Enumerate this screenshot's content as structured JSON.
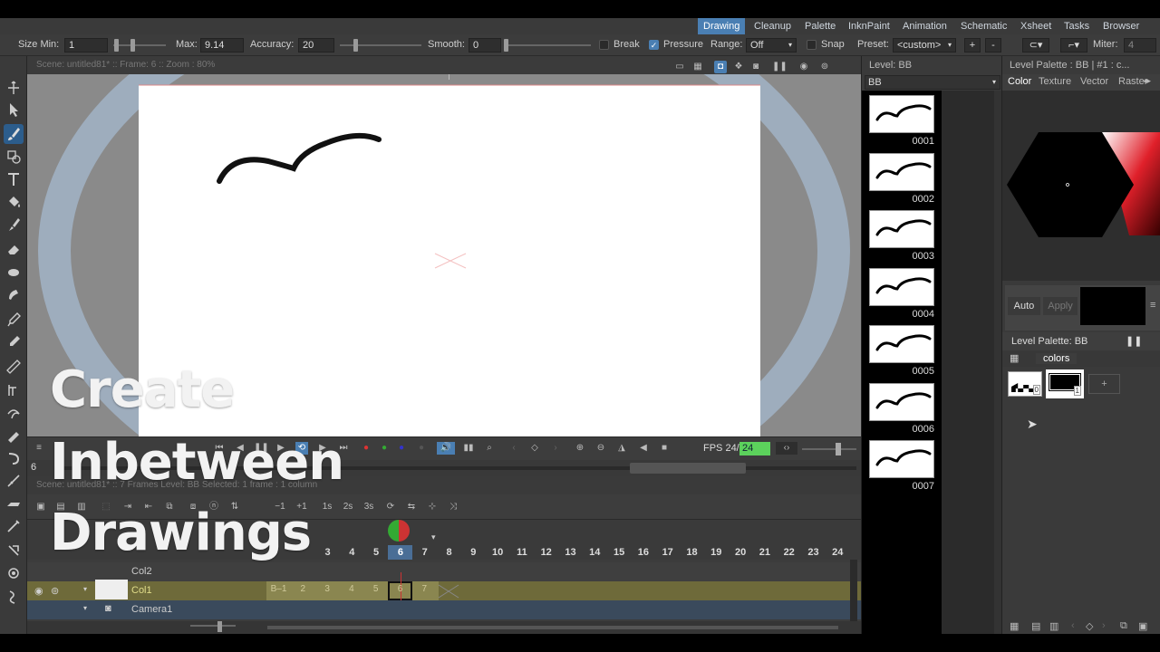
{
  "rooms": [
    "Drawing",
    "Cleanup",
    "Palette",
    "InknPaint",
    "Animation",
    "Schematic",
    "Xsheet",
    "Tasks",
    "Browser"
  ],
  "active_room": "Drawing",
  "tool_options": {
    "size_label": "Size Min:",
    "size_min": "1",
    "max_label": "Max:",
    "max_value": "9.14",
    "accuracy_label": "Accuracy:",
    "accuracy_value": "20",
    "smooth_label": "Smooth:",
    "smooth_value": "0",
    "break_label": "Break",
    "pressure_label": "Pressure",
    "pressure_checked": true,
    "range_label": "Range:",
    "range_value": "Off",
    "snap_label": "Snap",
    "preset_label": "Preset:",
    "preset_value": "<custom>",
    "miter_label": "Miter:",
    "miter_value": "4"
  },
  "viewer": {
    "info": "Scene: untitled81*  ::  Frame: 6  ::  Zoom : 80%",
    "fps_label": "FPS 24/",
    "fps_value": "24",
    "frame_field": "6"
  },
  "xsheet": {
    "info": "Scene: untitled81*  ::  7 Frames  Level: BB  Selected: 1 frame : 1 column",
    "step_buttons": [
      "−1",
      "+1",
      "1s",
      "2s",
      "3s"
    ],
    "frames": [
      "3",
      "4",
      "5",
      "6",
      "7",
      "8",
      "9",
      "10",
      "11",
      "12",
      "13",
      "14",
      "15",
      "16",
      "17",
      "18",
      "19",
      "20",
      "21",
      "22",
      "23",
      "24"
    ],
    "current_frame": "6",
    "columns": [
      {
        "name": "Col2"
      },
      {
        "name": "Col1",
        "cells": [
          "B–1",
          "2",
          "3",
          "4",
          "5",
          "6",
          "7"
        ]
      },
      {
        "name": "Camera1"
      }
    ]
  },
  "level_strip": {
    "title": "Level:  BB",
    "level_name": "BB",
    "frames": [
      "0001",
      "0002",
      "0003",
      "0004",
      "0005",
      "0006",
      "0007"
    ]
  },
  "palette": {
    "header": "Level Palette : BB | #1 : c...",
    "tabs": [
      "Color",
      "Texture",
      "Vector",
      "Raster"
    ],
    "auto_label": "Auto",
    "apply_label": "Apply",
    "level_palette_label": "Level Palette: BB",
    "page_name": "colors",
    "styles": [
      "0",
      "1"
    ],
    "add_label": "+"
  },
  "overlay": {
    "line1": "Create",
    "line2": "Inbetween",
    "line3": "Drawings"
  }
}
